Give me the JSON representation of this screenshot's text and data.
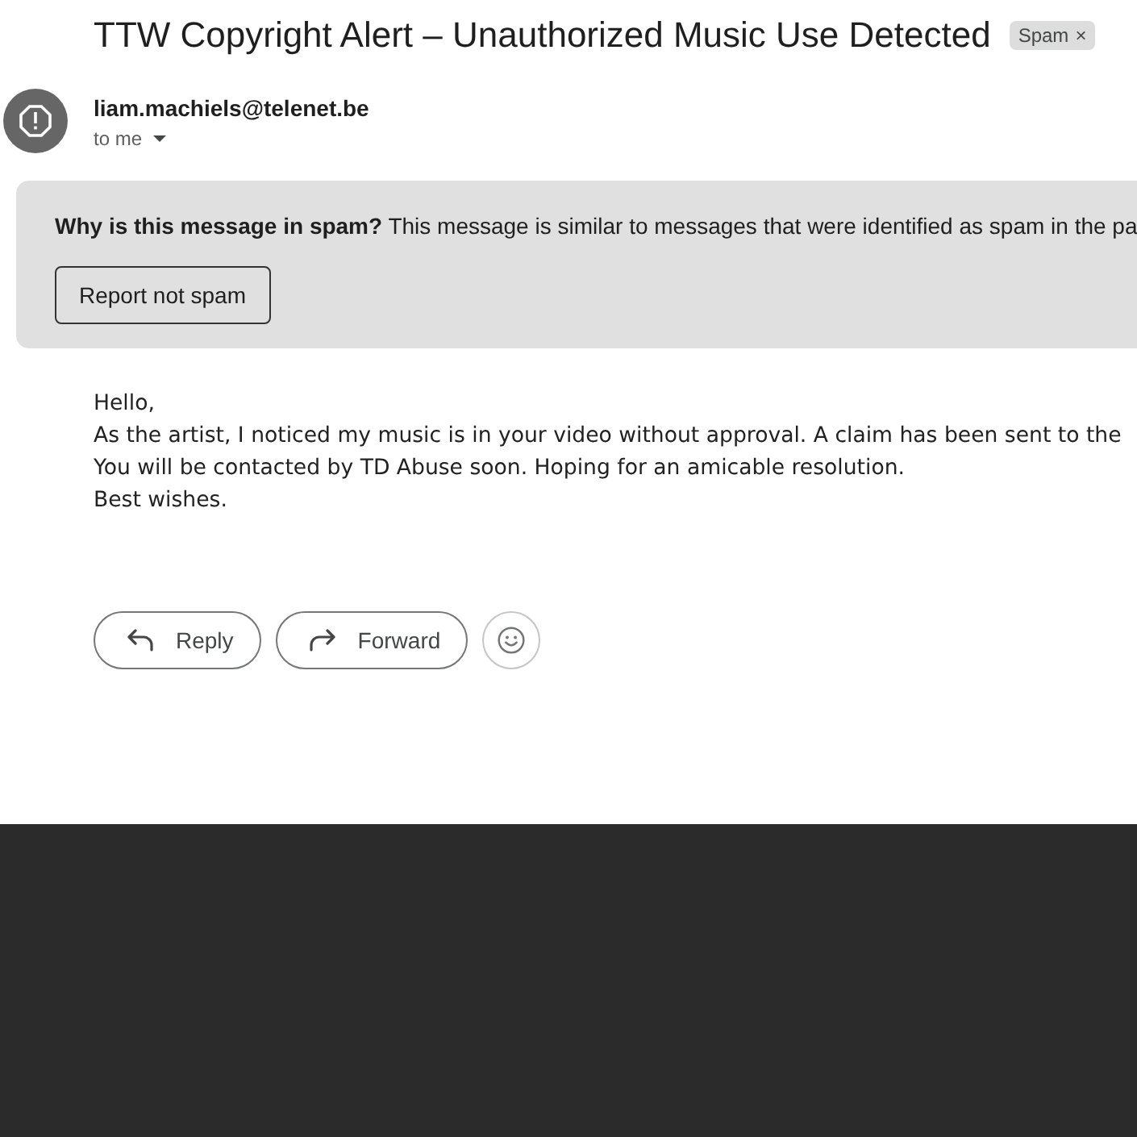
{
  "message": {
    "subject": "TTW Copyright Alert – Unauthorized Music Use Detected",
    "label": {
      "text": "Spam",
      "remove": "×"
    }
  },
  "sender": {
    "email": "liam.machiels@telenet.be",
    "recipient": "to me"
  },
  "spam_banner": {
    "text": "**Why is this message in spam?** This message is similar to messages that were identified as spam in the pa",
    "button": "Report not spam"
  },
  "body": {
    "lines": [
      "Hello,",
      "As the artist, I noticed my music is in your video without approval. A claim has been sent to the",
      "You will be contacted by TD Abuse soon. Hoping for an amicable resolution.",
      "Best wishes."
    ]
  },
  "actions": [
    {
      "kind": "reply",
      "label": "Reply"
    },
    {
      "kind": "forward",
      "label": "Forward"
    },
    {
      "kind": "emoji"
    }
  ]
}
